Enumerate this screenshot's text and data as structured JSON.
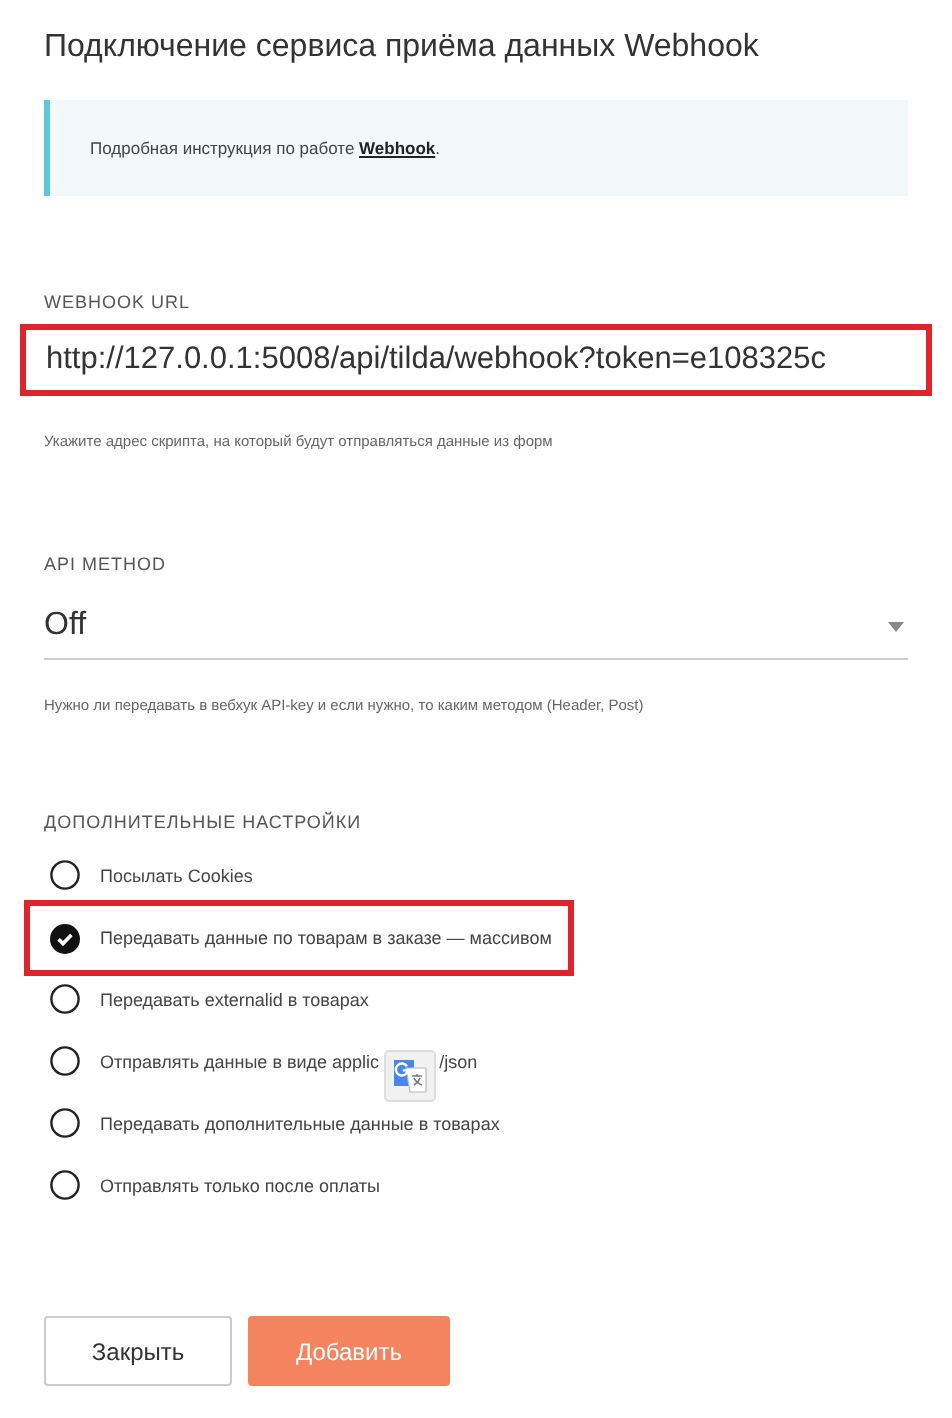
{
  "title": "Подключение сервиса приёма данных Webhook",
  "info": {
    "text": "Подробная инструкция по работе ",
    "link": "Webhook",
    "after": "."
  },
  "url_field": {
    "label": "WEBHOOK URL",
    "value": "http://127.0.0.1:5008/api/tilda/webhook?token=e108325c",
    "highlighted": true,
    "hint": "Укажите адрес скрипта, на который будут отправляться данные из форм"
  },
  "api_method": {
    "label": "API METHOD",
    "value": "Off",
    "hint": "Нужно ли передавать в вебхук API-key и если нужно, то каким методом (Header, Post)"
  },
  "settings": {
    "label": "ДОПОЛНИТЕЛЬНЫЕ НАСТРОЙКИ",
    "options": [
      {
        "kind": "plain",
        "label": "Посылать Cookies",
        "selected": false,
        "highlighted": false
      },
      {
        "kind": "plain",
        "label": "Передавать данные по товарам в заказе — массивом",
        "selected": true,
        "highlighted": true
      },
      {
        "kind": "plain",
        "label": "Передавать externalid в товарах",
        "selected": false,
        "highlighted": false
      },
      {
        "kind": "covered",
        "label": "Отправлять данные в виде applic",
        "label_after": "/json",
        "selected": false,
        "highlighted": false
      },
      {
        "kind": "plain",
        "label": "Передавать дополнительные данные в товарах",
        "selected": false,
        "highlighted": false
      },
      {
        "kind": "plain",
        "label": "Отправлять только после оплаты",
        "selected": false,
        "highlighted": false
      }
    ]
  },
  "buttons": [
    {
      "label": "Закрыть",
      "kind": "secondary"
    },
    {
      "label": "Добавить",
      "kind": "primary"
    }
  ]
}
